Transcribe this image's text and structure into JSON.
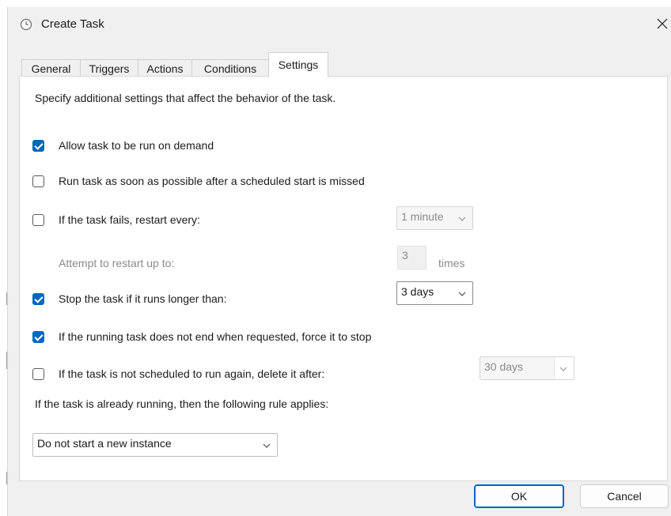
{
  "window": {
    "title": "Create Task",
    "close_glyph": "✕"
  },
  "tabs": [
    {
      "label": "General"
    },
    {
      "label": "Triggers"
    },
    {
      "label": "Actions"
    },
    {
      "label": "Conditions"
    },
    {
      "label": "Settings",
      "active": true
    }
  ],
  "settings": {
    "intro": "Specify additional settings that affect the behavior of the task.",
    "allow_on_demand": {
      "label": "Allow task to be run on demand",
      "checked": true
    },
    "run_asap": {
      "label": "Run task as soon as possible after a scheduled start is missed",
      "checked": false
    },
    "restart_every": {
      "label": "If the task fails, restart every:",
      "checked": false,
      "value": "1 minute"
    },
    "restart_attempts": {
      "label": "Attempt to restart up to:",
      "value": "3",
      "unit": "times"
    },
    "stop_if_longer": {
      "label": "Stop the task if it runs longer than:",
      "checked": true,
      "value": "3 days"
    },
    "force_stop": {
      "label": "If the running task does not end when requested, force it to stop",
      "checked": true
    },
    "delete_after": {
      "label": "If the task is not scheduled to run again, delete it after:",
      "checked": false,
      "value": "30 days"
    },
    "rule_label": "If the task is already running, then the following rule applies:",
    "rule_value": "Do not start a new instance"
  },
  "buttons": {
    "ok": "OK",
    "cancel": "Cancel"
  },
  "colors": {
    "accent": "#0067c0",
    "window_bg": "#f0f0f0",
    "panel_bg": "#ffffff",
    "disabled_text": "#8a8a8a"
  },
  "icons": {
    "app": "clock-icon",
    "close": "close-icon",
    "dropdown": "chevron-down-icon",
    "check": "checkmark-icon"
  }
}
